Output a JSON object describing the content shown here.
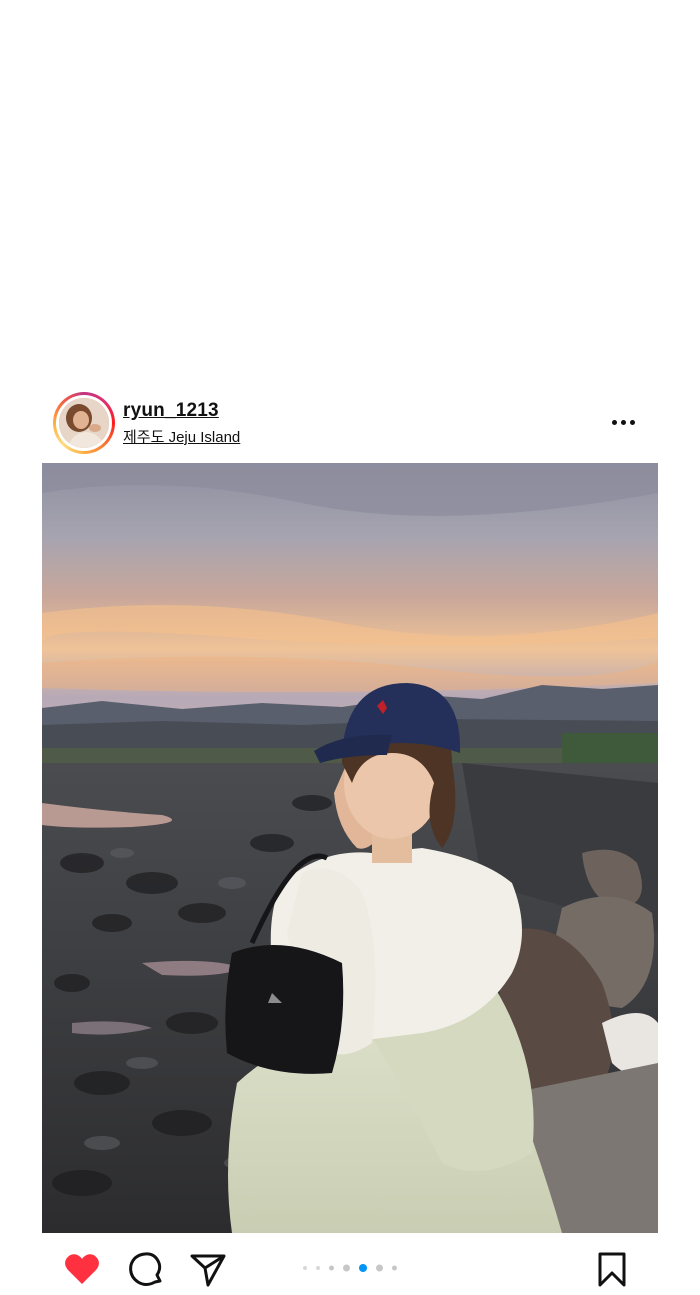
{
  "post": {
    "username": "ryun_1213",
    "location": "제주도 Jeju Island",
    "liked": true,
    "carousel": {
      "total": 7,
      "active_index": 4
    }
  },
  "icons": {
    "more": "more-options-icon",
    "like": "heart-filled-icon",
    "comment": "comment-icon",
    "share": "paper-plane-icon",
    "save": "bookmark-icon"
  },
  "colors": {
    "like_red": "#ff3040",
    "dot_active": "#0095f6",
    "dot_inactive": "#c7c7c7",
    "text": "#111111"
  }
}
